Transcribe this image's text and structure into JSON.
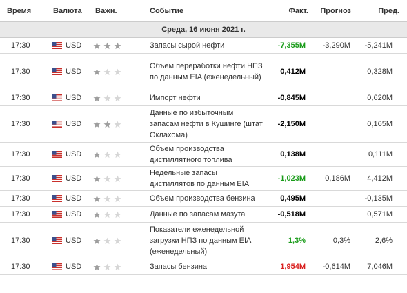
{
  "headers": {
    "time": "Время",
    "currency": "Валюта",
    "importance": "Важн.",
    "event": "Событие",
    "actual": "Факт.",
    "forecast": "Прогноз",
    "previous": "Пред."
  },
  "date_label": "Среда, 16 июня 2021 г.",
  "colors": {
    "positive": "#1a9c1a",
    "negative": "#d9201f",
    "star_on": "#9e9e9e",
    "star_off": "#d6d6d6"
  },
  "rows": [
    {
      "time": "17:30",
      "currency": "USD",
      "stars": 3,
      "event": "Запасы сырой нефти",
      "actual": "-7,355M",
      "actual_tone": "pos",
      "forecast": "-3,290M",
      "previous": "-5,241M"
    },
    {
      "time": "17:30",
      "currency": "USD",
      "stars": 1,
      "event": "Объем переработки нефти НПЗ по данным EIA (еженедельный)",
      "actual": "0,412M",
      "actual_tone": "neu",
      "forecast": "",
      "previous": "0,328M"
    },
    {
      "time": "17:30",
      "currency": "USD",
      "stars": 1,
      "event": "Импорт нефти",
      "actual": "-0,845M",
      "actual_tone": "neu",
      "forecast": "",
      "previous": "0,620M"
    },
    {
      "time": "17:30",
      "currency": "USD",
      "stars": 2,
      "event": "Данные по избыточным запасам нефти в Кушинге (штат Оклахома)",
      "actual": "-2,150M",
      "actual_tone": "neu",
      "forecast": "",
      "previous": "0,165M"
    },
    {
      "time": "17:30",
      "currency": "USD",
      "stars": 1,
      "event": "Объем производства дистиллятного топлива",
      "actual": "0,138M",
      "actual_tone": "neu",
      "forecast": "",
      "previous": "0,111M"
    },
    {
      "time": "17:30",
      "currency": "USD",
      "stars": 1,
      "event": "Недельные запасы дистиллятов по данным EIA",
      "actual": "-1,023M",
      "actual_tone": "pos",
      "forecast": "0,186M",
      "previous": "4,412M"
    },
    {
      "time": "17:30",
      "currency": "USD",
      "stars": 1,
      "event": "Объем производства бензина",
      "actual": "0,495M",
      "actual_tone": "neu",
      "forecast": "",
      "previous": "-0,135M"
    },
    {
      "time": "17:30",
      "currency": "USD",
      "stars": 1,
      "event": "Данные по запасам мазута",
      "actual": "-0,518M",
      "actual_tone": "neu",
      "forecast": "",
      "previous": "0,571M"
    },
    {
      "time": "17:30",
      "currency": "USD",
      "stars": 1,
      "event": "Показатели еженедельной загрузки НПЗ по данным EIA (еженедельный)",
      "actual": "1,3%",
      "actual_tone": "pos",
      "forecast": "0,3%",
      "previous": "2,6%"
    },
    {
      "time": "17:30",
      "currency": "USD",
      "stars": 1,
      "event": "Запасы бензина",
      "actual": "1,954M",
      "actual_tone": "neg",
      "forecast": "-0,614M",
      "previous": "7,046M"
    }
  ]
}
